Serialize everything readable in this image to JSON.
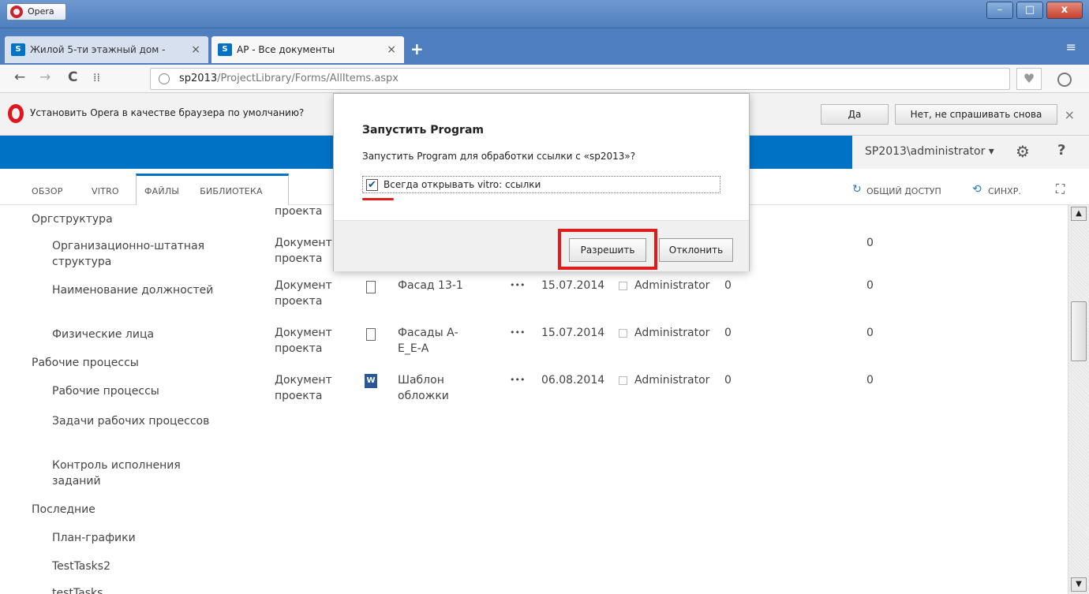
{
  "window": {
    "app_button": "Opera",
    "minimize": "–",
    "maximize": "□",
    "close": "x"
  },
  "tabs": [
    {
      "label": "Жилой 5-ти этажный дом -",
      "icon": "S",
      "close": "×"
    },
    {
      "label": "AP - Все документы",
      "icon": "S",
      "close": "×"
    }
  ],
  "new_tab": "+",
  "tab_menu": "≡",
  "nav": {
    "back": "←",
    "forward": "→",
    "reload": "C",
    "speed_dial": "⁞⁞",
    "url_host": "sp2013",
    "url_path": "/ProjectLibrary/Forms/AllItems.aspx",
    "bookmark": "♥"
  },
  "infobar": {
    "text": "Установить Opera в качестве браузера по умолчанию?",
    "yes": "Да",
    "never": "Нет, не спрашивать снова",
    "close": "×"
  },
  "suite": {
    "user": "SP2013\\administrator ▾",
    "gear": "⚙",
    "help": "?"
  },
  "ribbon": {
    "tabs": [
      "ОБЗОР",
      "VITRO",
      "ФАЙЛЫ",
      "БИБЛИОТЕКА"
    ],
    "share": "ОБЩИЙ ДОСТУП",
    "sync": "СИНХР.",
    "focus": "⛶"
  },
  "quicknav": {
    "h1": "Оргструктура",
    "s1": "Организационно-штатная структура",
    "s2": "Наименование должностей",
    "s3": "Физические лица",
    "h2": "Рабочие процессы",
    "s4": "Рабочие процессы",
    "s5": "Задачи рабочих процессов",
    "s6": "Контроль исполнения заданий",
    "h3": "Последние",
    "s7": "План-графики",
    "s8": "TestTasks2",
    "s9": "testTasks"
  },
  "rows": [
    {
      "type": "проекта",
      "name": "",
      "date": "",
      "author": "",
      "ver": "",
      "count": ""
    },
    {
      "type": "Документ проекта",
      "name": "",
      "date": "",
      "author": "",
      "ver": "",
      "count": "0"
    },
    {
      "type": "Документ проекта",
      "name": "Фасад 13-1",
      "ellipsis": "•••",
      "date": "15.07.2014",
      "author": "Administrator",
      "ver": "0",
      "count": "0"
    },
    {
      "type": "Документ проекта",
      "name": "Фасады А-Е_Е-А",
      "ellipsis": "•••",
      "date": "15.07.2014",
      "author": "Administrator",
      "ver": "0",
      "count": "0"
    },
    {
      "type": "Документ проекта",
      "name": "Шаблон обложки",
      "ellipsis": "•••",
      "date": "06.08.2014",
      "author": "Administrator",
      "ver": "0",
      "count": "0"
    }
  ],
  "dialog": {
    "title": "Запустить Program",
    "message": "Запустить Program для обработки ссылки с «sp2013»?",
    "check_mark": "✔",
    "checkbox_label": "Всегда открывать vitro: ссылки",
    "allow": "Разрешить",
    "deny": "Отклонить"
  },
  "scroll": {
    "up": "▲",
    "down": "▼"
  },
  "colors": {
    "sharepoint_blue": "#0072c6",
    "highlight_red": "#e01b1b",
    "opera_red": "#e2151d"
  }
}
